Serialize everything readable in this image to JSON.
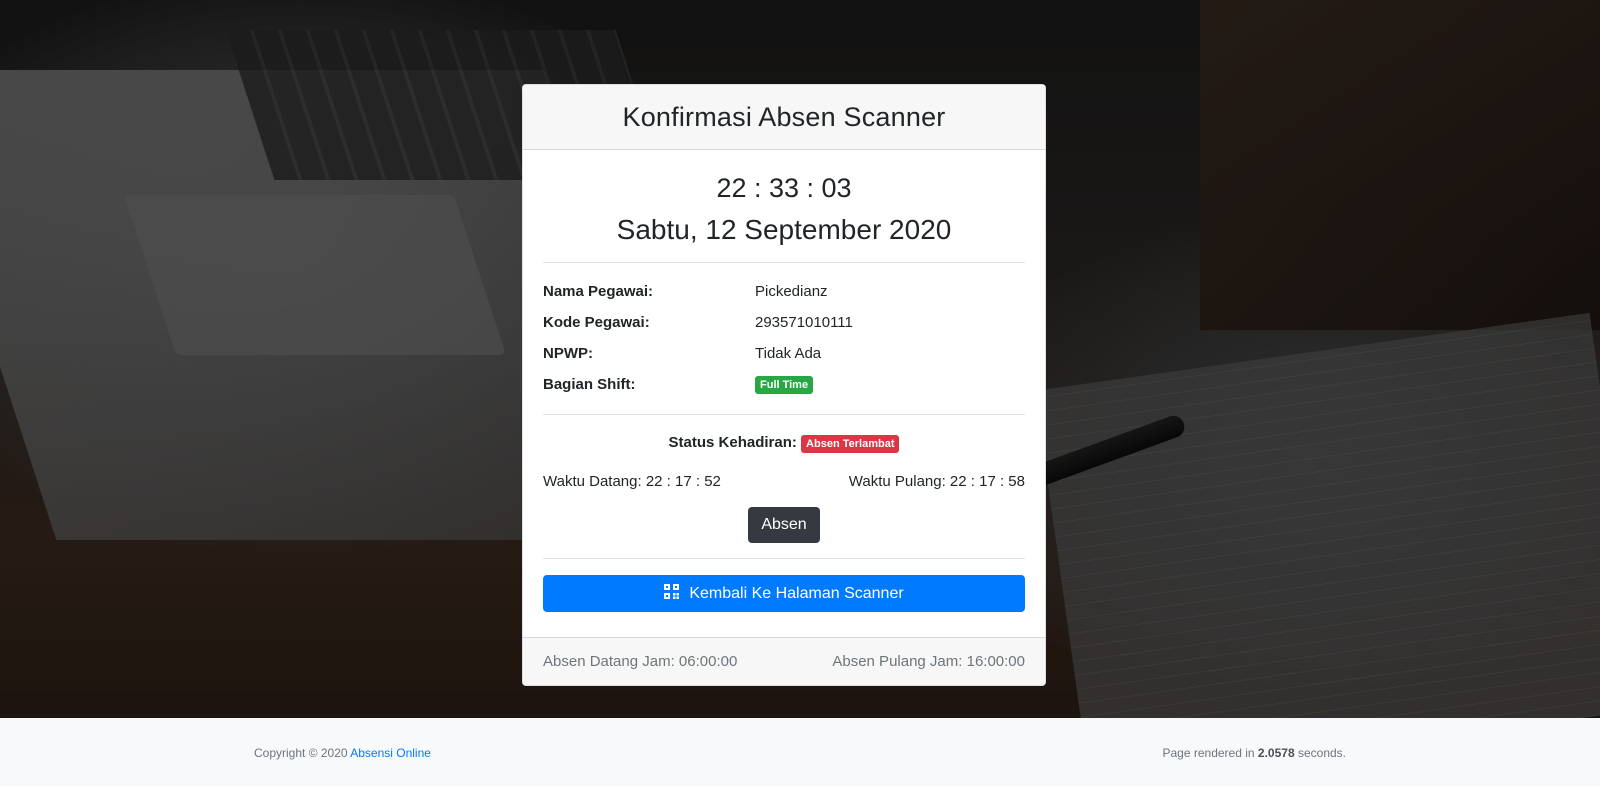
{
  "card": {
    "title": "Konfirmasi Absen Scanner",
    "clock": "22 : 33 : 03",
    "date": "Sabtu, 12 September 2020"
  },
  "employee": {
    "name_label": "Nama Pegawai:",
    "name_value": "Pickedianz",
    "code_label": "Kode Pegawai:",
    "code_value": "293571010111",
    "npwp_label": "NPWP:",
    "npwp_value": "Tidak Ada",
    "shift_label": "Bagian Shift:",
    "shift_badge": "Full Time"
  },
  "attendance": {
    "status_label": "Status Kehadiran:",
    "status_badge": "Absen Terlambat",
    "arrival": "Waktu Datang: 22 : 17 : 52",
    "departure": "Waktu Pulang: 22 : 17 : 58",
    "absen_button": "Absen",
    "back_button": "Kembali Ke Halaman Scanner"
  },
  "card_footer": {
    "arrive_schedule": "Absen Datang Jam: 06:00:00",
    "leave_schedule": "Absen Pulang Jam: 16:00:00"
  },
  "page_footer": {
    "copyright": "Copyright © 2020",
    "brand_link": "Absensi Online",
    "render_prefix": "Page rendered in",
    "render_time": "2.0578",
    "render_suffix": "seconds."
  },
  "colors": {
    "primary": "#007bff",
    "success": "#28a745",
    "danger": "#dc3545",
    "dark": "#343a40"
  },
  "icons": {
    "back_button_icon": "qr-code-icon"
  }
}
